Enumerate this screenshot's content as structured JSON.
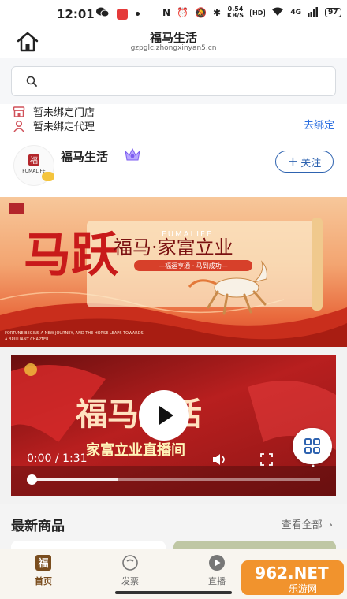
{
  "status_bar": {
    "time": "12:01",
    "net_speed": "0.54",
    "net_unit": "KB/S",
    "hd": "HD",
    "signal": "4G",
    "battery": "97"
  },
  "header": {
    "title": "福马生活",
    "url": "gzpglc.zhongxinyan5.cn"
  },
  "search": {
    "placeholder": ""
  },
  "bind": {
    "store": "暂未绑定门店",
    "agent": "暂未绑定代理",
    "link": "去绑定"
  },
  "shop": {
    "name": "福马生活",
    "logo_text": "FUMALIFE",
    "follow_label": "关注"
  },
  "banner": {
    "headline": "马跃",
    "slogan": "福马·家富立业",
    "brand": "FUMALIFE",
    "subline": "—福运亨通 · 马到成功—",
    "caption_line1": "FORTUNE BEGINS A NEW JOURNEY, AND THE HORSE LEAPS TOWARDS",
    "caption_line2": "A BRILLIANT CHAPTER"
  },
  "video": {
    "title": "福马生活",
    "subtitle": "家富立业直播间",
    "current_time": "0:00",
    "duration": "1:31",
    "progress": 0.0
  },
  "latest": {
    "title": "最新商品",
    "view_all": "查看全部"
  },
  "tabs": [
    {
      "label": "首页",
      "active": true
    },
    {
      "label": "发票",
      "active": false
    },
    {
      "label": "直播",
      "active": false
    }
  ],
  "watermark": {
    "text": "962.NET",
    "subtext": "乐游网"
  },
  "colors": {
    "link": "#2a6ee0",
    "follow": "#2e63b0",
    "tab_active": "#7a4d1e",
    "banner_red": "#c92e1c"
  }
}
